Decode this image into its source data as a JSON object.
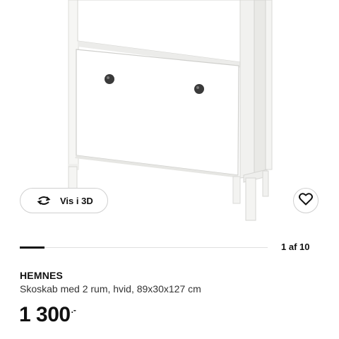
{
  "product": {
    "name": "HEMNES",
    "description": "Skoskab med 2 rum, hvid, 89x30x127 cm",
    "price_main": "1 300",
    "price_suffix": ".-"
  },
  "viewer": {
    "view_3d_label": "Vis i 3D",
    "view_3d_icon": "rotate-3d-icon",
    "favourite_icon": "heart-icon"
  },
  "gallery": {
    "counter": "1 af 10",
    "current": 1,
    "total": 10
  }
}
